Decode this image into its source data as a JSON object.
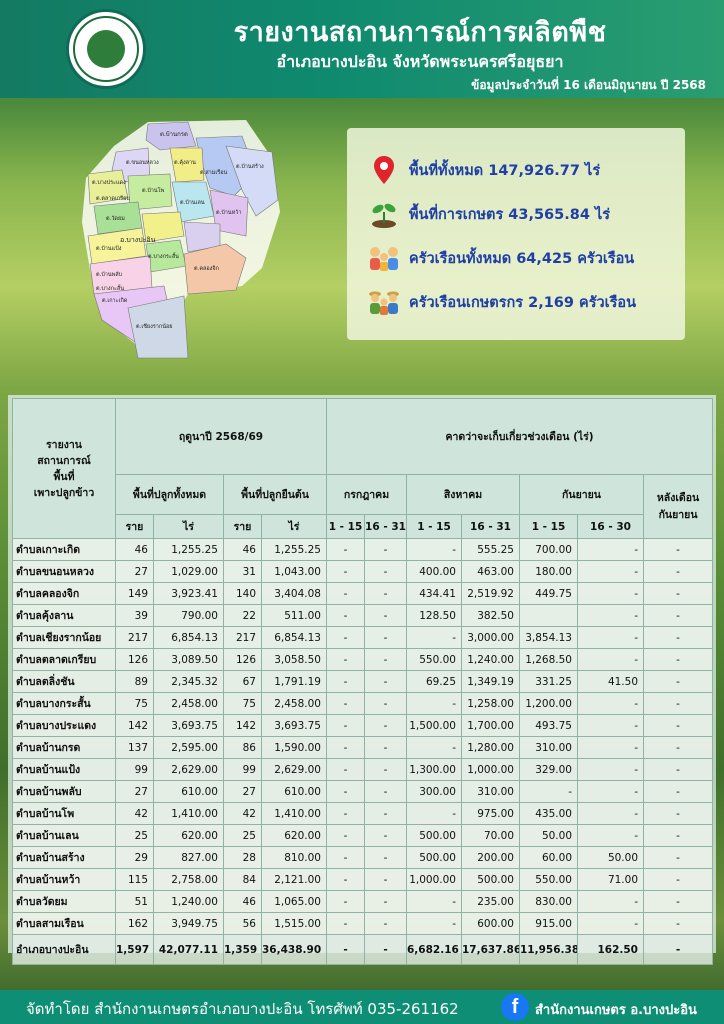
{
  "header": {
    "title": "รายงานสถานการณ์การผลิตพืช",
    "subtitle": "อำเภอบางปะอิน จังหวัดพระนครศรีอยุธยา",
    "date_line": "ข้อมูลประจำวันที่ 16 เดือนมิถุนายน ปี 2568"
  },
  "map": {
    "labels": [
      "ต.บ้านกรด",
      "ต.ขนอนหลวง",
      "ต.บางประแดง",
      "ต.คุ้งลาน",
      "ต.สามเรือน",
      "ต.บ้านสร้าง",
      "ต.ตลาดเกรียบ",
      "ต.บ้านโพ",
      "ต.บ้านเลน",
      "ต.วัดยม",
      "ต.บ้านหว้า",
      "ต.บ้านแป้ง",
      "อ.บางปะอิน",
      "ต.บางกระสั้น",
      "ต.คลองจิก",
      "ต.บ้านพลับ",
      "ต.เกาะเกิด",
      "ต.บางกะสั้น",
      "ต.เชียงรากน้อย"
    ]
  },
  "info": {
    "total_area": "พื้นที่ทั้งหมด 147,926.77 ไร่",
    "agri_area": "พื้นที่การเกษตร 43,565.84 ไร่",
    "households": "ครัวเรือนทั้งหมด 64,425 ครัวเรือน",
    "farm_households": "ครัวเรือนเกษตรกร 2,169 ครัวเรือน",
    "icons": [
      "location-pin-icon",
      "seedling-icon",
      "family-icon",
      "farmers-icon"
    ]
  },
  "table": {
    "corner_header": "รายงาน\nสถานการณ์\nพื้นที่\nเพาะปลูกข้าว",
    "season_header": "ฤดูนาปี 2568/69",
    "harvest_header": "คาดว่าจะเก็บเกี่ยวช่วงเดือน (ไร่)",
    "planted_header": "พื้นที่ปลูกทั้งหมด",
    "standing_header": "พื้นที่ปลูกยืนต้น",
    "months": [
      "กรกฎาคม",
      "สิงหาคม",
      "กันยายน"
    ],
    "after_sep": "หลังเดือน\nกันยายน",
    "unit_households": "ราย",
    "unit_rai": "ไร่",
    "periods": [
      "1 - 15",
      "16 - 31",
      "1 - 15",
      "16 - 31",
      "1 - 15",
      "16 - 30"
    ],
    "rows": [
      [
        "ตำบลเกาะเกิด",
        "46",
        "1,255.25",
        "46",
        "1,255.25",
        "-",
        "-",
        "-",
        "555.25",
        "700.00",
        "-",
        "-"
      ],
      [
        "ตำบลขนอนหลวง",
        "27",
        "1,029.00",
        "31",
        "1,043.00",
        "-",
        "-",
        "400.00",
        "463.00",
        "180.00",
        "-",
        "-"
      ],
      [
        "ตำบลคลองจิก",
        "149",
        "3,923.41",
        "140",
        "3,404.08",
        "-",
        "-",
        "434.41",
        "2,519.92",
        "449.75",
        "-",
        "-"
      ],
      [
        "ตำบลคุ้งลาน",
        "39",
        "790.00",
        "22",
        "511.00",
        "-",
        "-",
        "128.50",
        "382.50",
        "",
        "-",
        "-"
      ],
      [
        "ตำบลเชียงรากน้อย",
        "217",
        "6,854.13",
        "217",
        "6,854.13",
        "-",
        "-",
        "-",
        "3,000.00",
        "3,854.13",
        "-",
        "-"
      ],
      [
        "ตำบลตลาดเกรียบ",
        "126",
        "3,089.50",
        "126",
        "3,058.50",
        "-",
        "-",
        "550.00",
        "1,240.00",
        "1,268.50",
        "-",
        "-"
      ],
      [
        "ตำบลตลิ่งชัน",
        "89",
        "2,345.32",
        "67",
        "1,791.19",
        "-",
        "-",
        "69.25",
        "1,349.19",
        "331.25",
        "41.50",
        "-"
      ],
      [
        "ตำบลบางกระสั้น",
        "75",
        "2,458.00",
        "75",
        "2,458.00",
        "-",
        "-",
        "-",
        "1,258.00",
        "1,200.00",
        "-",
        "-"
      ],
      [
        "ตำบลบางประแดง",
        "142",
        "3,693.75",
        "142",
        "3,693.75",
        "-",
        "-",
        "1,500.00",
        "1,700.00",
        "493.75",
        "-",
        "-"
      ],
      [
        "ตำบลบ้านกรด",
        "137",
        "2,595.00",
        "86",
        "1,590.00",
        "-",
        "-",
        "-",
        "1,280.00",
        "310.00",
        "-",
        "-"
      ],
      [
        "ตำบลบ้านแป้ง",
        "99",
        "2,629.00",
        "99",
        "2,629.00",
        "-",
        "-",
        "1,300.00",
        "1,000.00",
        "329.00",
        "-",
        "-"
      ],
      [
        "ตำบลบ้านพลับ",
        "27",
        "610.00",
        "27",
        "610.00",
        "-",
        "-",
        "300.00",
        "310.00",
        "-",
        "-",
        "-"
      ],
      [
        "ตำบลบ้านโพ",
        "42",
        "1,410.00",
        "42",
        "1,410.00",
        "-",
        "-",
        "-",
        "975.00",
        "435.00",
        "-",
        "-"
      ],
      [
        "ตำบลบ้านเลน",
        "25",
        "620.00",
        "25",
        "620.00",
        "-",
        "-",
        "500.00",
        "70.00",
        "50.00",
        "-",
        "-"
      ],
      [
        "ตำบลบ้านสร้าง",
        "29",
        "827.00",
        "28",
        "810.00",
        "-",
        "-",
        "500.00",
        "200.00",
        "60.00",
        "50.00",
        "-"
      ],
      [
        "ตำบลบ้านหว้า",
        "115",
        "2,758.00",
        "84",
        "2,121.00",
        "-",
        "-",
        "1,000.00",
        "500.00",
        "550.00",
        "71.00",
        "-"
      ],
      [
        "ตำบลวัดยม",
        "51",
        "1,240.00",
        "46",
        "1,065.00",
        "-",
        "-",
        "-",
        "235.00",
        "830.00",
        "-",
        "-"
      ],
      [
        "ตำบลสามเรือน",
        "162",
        "3,949.75",
        "56",
        "1,515.00",
        "-",
        "-",
        "-",
        "600.00",
        "915.00",
        "-",
        "-"
      ]
    ],
    "total": [
      "อำเภอบางปะอิน",
      "1,597",
      "42,077.11",
      "1,359",
      "36,438.90",
      "-",
      "-",
      "6,682.16",
      "17,637.86",
      "11,956.38",
      "162.50",
      "-"
    ]
  },
  "footer": {
    "credit": "จัดทำโดย สำนักงานเกษตรอำเภอบางปะอิน โทรศัพท์ 035-261162",
    "fb_letter": "f",
    "page": "สำนักงานเกษตร อ.บางปะอิน"
  }
}
